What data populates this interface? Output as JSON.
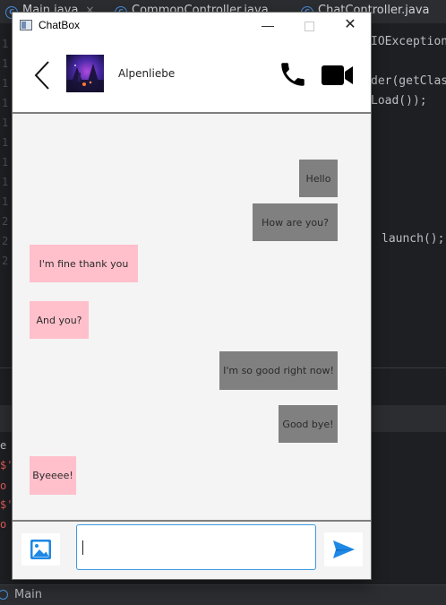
{
  "ide": {
    "tabs": [
      {
        "label": "Main.java",
        "close": "×"
      },
      {
        "label": "CommonController.java"
      },
      {
        "label": "ChatController.java"
      }
    ],
    "code_lines": [
      "IOException",
      "der(getClas",
      "Load());",
      "launch();"
    ],
    "console_lines": [
      "e",
      "$'",
      "o",
      "$'",
      "o"
    ],
    "gutter_numbers": [
      "1",
      "1",
      "1",
      "1",
      "1",
      "1",
      "1",
      "1",
      "1",
      "2",
      "2",
      "2",
      "2",
      "2",
      "2"
    ],
    "status_label": "Main"
  },
  "window": {
    "title": "ChatBox",
    "minimize": "—",
    "close": "✕"
  },
  "contact": {
    "name": "Alpenliebe"
  },
  "messages": [
    {
      "text": "Hello",
      "from": "me"
    },
    {
      "text": "How are you?",
      "from": "me"
    },
    {
      "text": "I'm fine thank you",
      "from": "them"
    },
    {
      "text": "And you?",
      "from": "them"
    },
    {
      "text": "I'm so good right now!",
      "from": "me"
    },
    {
      "text": "Good bye!",
      "from": "me"
    },
    {
      "text": "Byeeee!",
      "from": "them"
    }
  ],
  "composer": {
    "value": "",
    "placeholder": ""
  },
  "icons": {
    "back": "chevron-left-icon",
    "call": "phone-icon",
    "video": "video-camera-icon",
    "image": "image-icon",
    "send": "send-icon"
  },
  "colors": {
    "sent_bubble": "#808080",
    "received_bubble": "#ffc0cb",
    "accent": "#1e88e5",
    "input_border": "#3c9be0"
  }
}
